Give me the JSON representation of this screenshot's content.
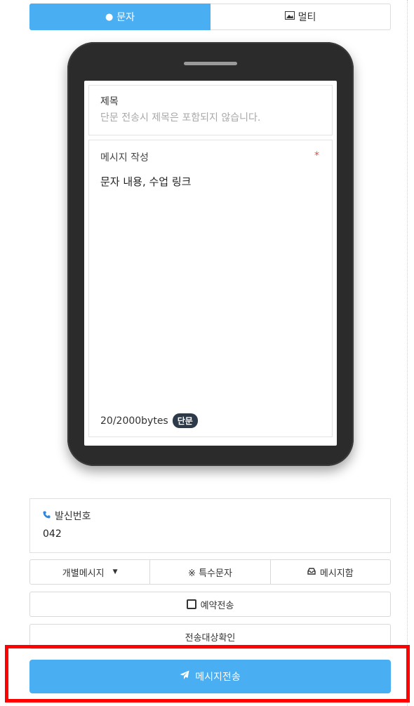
{
  "tabs": {
    "sms_label": "문자",
    "mms_label": "멀티"
  },
  "composer": {
    "subject_label": "제목",
    "subject_placeholder": "단문 전송시 제목은 포함되지 않습니다.",
    "message_label": "메시지 작성",
    "required_mark": "*",
    "message_value": "문자 내용, 수업 링크",
    "byte_count": "20/2000bytes",
    "message_type_badge": "단문"
  },
  "sender": {
    "label": "발신번호",
    "value": "042"
  },
  "actions": {
    "individual_message": "개별메시지",
    "special_chars": "※ 특수문자",
    "message_box": "메시지함",
    "reserve_send": "예약전송",
    "check_recipients": "전송대상확인",
    "send_message": "메시지전송"
  },
  "colors": {
    "accent": "#4aaef2",
    "highlight": "#ff0000",
    "badge": "#2d3a4a"
  }
}
